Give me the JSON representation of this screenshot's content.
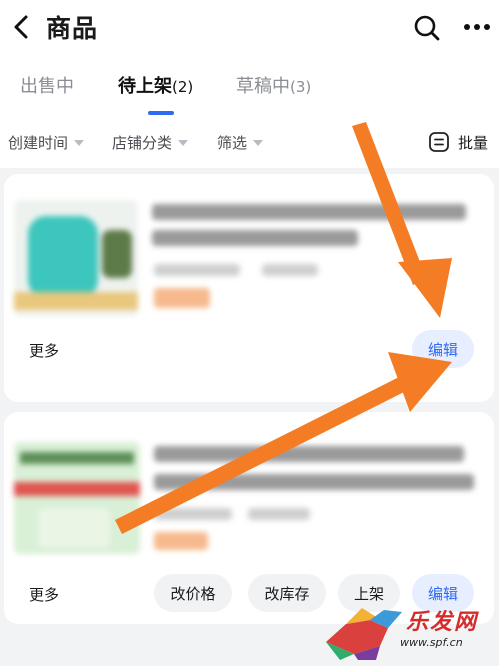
{
  "header": {
    "title": "商品",
    "back_icon": "chevron-left-icon",
    "search_icon": "search-icon",
    "more_icon": "more-icon"
  },
  "tabs": [
    {
      "label": "出售中"
    },
    {
      "label": "待上架",
      "count": "(2)",
      "active": true
    },
    {
      "label": "草稿中",
      "count": "(3)"
    }
  ],
  "filters": {
    "items": [
      "创建时间",
      "店铺分类",
      "筛选"
    ],
    "batch_label": "批量"
  },
  "cards": [
    {
      "more_label": "更多",
      "edit_label": "编辑"
    },
    {
      "more_label": "更多",
      "change_price_label": "改价格",
      "change_stock_label": "改库存",
      "list_label": "上架",
      "edit_label": "编辑"
    }
  ],
  "colors": {
    "accent": "#2f6bf2",
    "arrow": "#f47c25",
    "price": "#f3863b"
  },
  "watermark": {
    "brand": "乐发网",
    "url": "www.spf.cn"
  }
}
